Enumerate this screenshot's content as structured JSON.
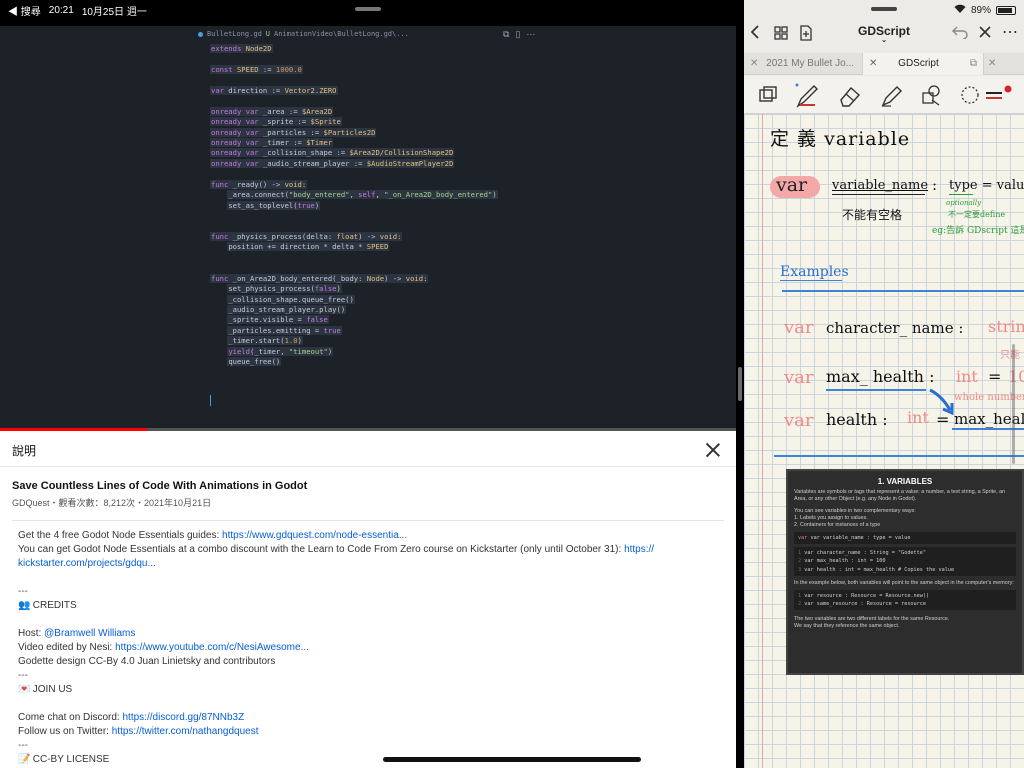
{
  "status_bar": {
    "back_app": "◀ 搜尋",
    "time": "20:21",
    "date": "10月25日 週一",
    "battery": "89%",
    "battery_level": 0.89
  },
  "video_player": {
    "progress": 0.2,
    "editor": {
      "file_tab": "BulletLong.gd",
      "modified_marker": "U",
      "file_path": "AnimationVideo\\BulletLong.gd\\...",
      "code_lines": [
        "extends Node2D",
        "",
        "const SPEED := 1000.0",
        "",
        "var direction := Vector2.ZERO",
        "",
        "onready var _area := $Area2D",
        "onready var _sprite := $Sprite",
        "onready var _particles := $Particles2D",
        "onready var _timer := $Timer",
        "onready var _collision_shape := $Area2D/CollisionShape2D",
        "onready var _audio_stream_player := $AudioStreamPlayer2D",
        "",
        "func _ready() -> void:",
        "    _area.connect(\"body_entered\", self, \"_on_Area2D_body_entered\")",
        "    set_as_toplevel(true)",
        "",
        "",
        "func _physics_process(delta: float) -> void:",
        "    position += direction * delta * SPEED",
        "",
        "",
        "func _on_Area2D_body_entered(_body: Node) -> void:",
        "    set_physics_process(false)",
        "    _collision_shape.queue_free()",
        "    _audio_stream_player.play()",
        "    _sprite.visible = false",
        "    _particles.emitting = true",
        "    _timer.start(1.0)",
        "    yield(_timer, \"timeout\")",
        "    queue_free()"
      ]
    }
  },
  "description": {
    "header": "說明",
    "title": "Save Countless Lines of Code With Animations in Godot",
    "meta": "GDQuest・觀看次數：8,212次・2021年10月21日",
    "lines": [
      {
        "text": "Get the 4 free Godot Node Essentials guides: ",
        "link": "https://www.gdquest.com/node-essentia..."
      },
      {
        "text": "You can get Godot Node Essentials at a combo discount with the Learn to Code From Zero course on Kickstarter (only until October 31): ",
        "link": "https://"
      },
      {
        "text": "",
        "link": "kickstarter.com/projects/gdqu..."
      },
      {
        "text": "",
        "link": ""
      },
      {
        "text": "---",
        "link": ""
      },
      {
        "text": "CREDITS",
        "emoji": "👥",
        "link": ""
      },
      {
        "text": "",
        "link": ""
      },
      {
        "text": "Host: ",
        "link": "@Bramwell Williams"
      },
      {
        "text": "Video edited by Nesi: ",
        "link": "https://www.youtube.com/c/NesiAwesome..."
      },
      {
        "text": "Godette design CC-By 4.0 Juan Linietsky and contributors",
        "link": ""
      },
      {
        "text": "---",
        "link": ""
      },
      {
        "text": "JOIN US",
        "emoji": "💌",
        "link": ""
      },
      {
        "text": "",
        "link": ""
      },
      {
        "text": "Come chat on Discord: ",
        "link": "https://discord.gg/87NNb3Z"
      },
      {
        "text": "Follow us on Twitter: ",
        "link": "https://twitter.com/nathangdquest"
      },
      {
        "text": "---",
        "link": ""
      },
      {
        "text": "CC-BY LICENSE",
        "emoji": "📝",
        "link": ""
      }
    ]
  },
  "notes_app": {
    "title": "GDScript",
    "tabs": [
      {
        "label": "2021 My Bullet Jo...",
        "active": false
      },
      {
        "label": "GDScript",
        "active": true
      }
    ],
    "tools": [
      "shapes-select",
      "pen",
      "eraser",
      "highlighter",
      "lasso",
      "color-dots"
    ],
    "pen_color": "#c0392b",
    "handwriting": {
      "heading": "定 義  variable",
      "var_word": "var",
      "syntax_name": "variable_name",
      "syntax_colon": ":",
      "syntax_type": "type = value",
      "note_no_space": "不能有空格",
      "note_optionally": "optionally",
      "note_not_required": "不一定要define",
      "note_eg": "eg:告訴 GDscript 這是",
      "examples_title": "Examples",
      "ex1_kw": "var",
      "ex1_name": "character_ name :",
      "ex1_type": "strin",
      "ex1_note": "只能",
      "ex2_kw": "var",
      "ex2_name": "max_ health :",
      "ex2_type": "int",
      "ex2_eq": "=",
      "ex2_val": "10",
      "ex2_note": "whole number",
      "ex3_kw": "var",
      "ex3_name": "health :",
      "ex3_type": "int",
      "ex3_eq": "=",
      "ex3_val": "max_heal"
    },
    "doc_card": {
      "heading": "1. VARIABLES",
      "para1": "Variables are symbols or tags that represent a value: a number, a text string, a Sprite, an Area, or any other Object (e.g. any Node in Godot).",
      "para2": "You can see variables in two complementary ways:",
      "list1": "1. Labels you assign to values.",
      "list2": "2. Containers for instances of a type",
      "code1": "var variable_name : type = value",
      "code2_lines": [
        "var character_name : String = \"Godette\"",
        "var max_health : int = 100",
        "var health : int = max_health  # Copies the value"
      ],
      "para3": "In the example below, both variables will point to the same object in the computer's memory:",
      "code3_lines": [
        "var resource : Resource = Resource.new()",
        "var same_resource : Resource = resource"
      ],
      "para4": "The two variables are two different labels for the same Resource.",
      "para5": "We say that they reference the same object."
    }
  }
}
